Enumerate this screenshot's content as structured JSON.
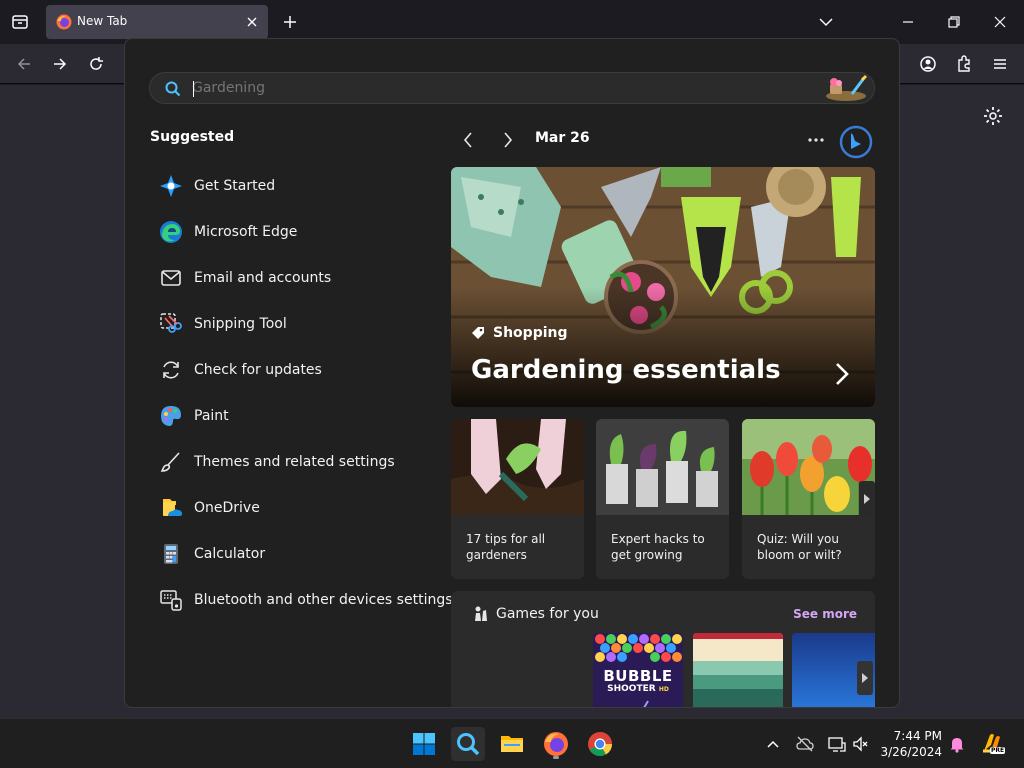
{
  "browser": {
    "tab_title": "New Tab"
  },
  "search": {
    "placeholder": "Gardening"
  },
  "suggested": {
    "title": "Suggested",
    "items": [
      {
        "label": "Get Started",
        "icon": "get-started-icon"
      },
      {
        "label": "Microsoft Edge",
        "icon": "edge-icon"
      },
      {
        "label": "Email and accounts",
        "icon": "mail-icon"
      },
      {
        "label": "Snipping Tool",
        "icon": "snipping-tool-icon"
      },
      {
        "label": "Check for updates",
        "icon": "refresh-icon"
      },
      {
        "label": "Paint",
        "icon": "paint-icon"
      },
      {
        "label": "Themes and related settings",
        "icon": "brush-icon"
      },
      {
        "label": "OneDrive",
        "icon": "onedrive-icon"
      },
      {
        "label": "Calculator",
        "icon": "calculator-icon"
      },
      {
        "label": "Bluetooth and other devices settings",
        "icon": "devices-icon"
      }
    ]
  },
  "news": {
    "date": "Mar 26",
    "hero": {
      "tag": "Shopping",
      "title": "Gardening essentials"
    },
    "cards": [
      {
        "text": "17 tips for all gardeners"
      },
      {
        "text": "Expert hacks to get growing"
      },
      {
        "text": "Quiz: Will you bloom or wilt?"
      }
    ]
  },
  "games": {
    "title": "Games for you",
    "see_more": "See more",
    "first_game": {
      "line1": "BUBBLE",
      "line2": "SHOOTER",
      "badge": "HD"
    }
  },
  "taskbar": {
    "time": "7:44 PM",
    "date": "3/26/2024",
    "copilot_badge": "PRE"
  },
  "colors": {
    "accent": "#0078d4",
    "see_more": "#d4a6f5"
  }
}
